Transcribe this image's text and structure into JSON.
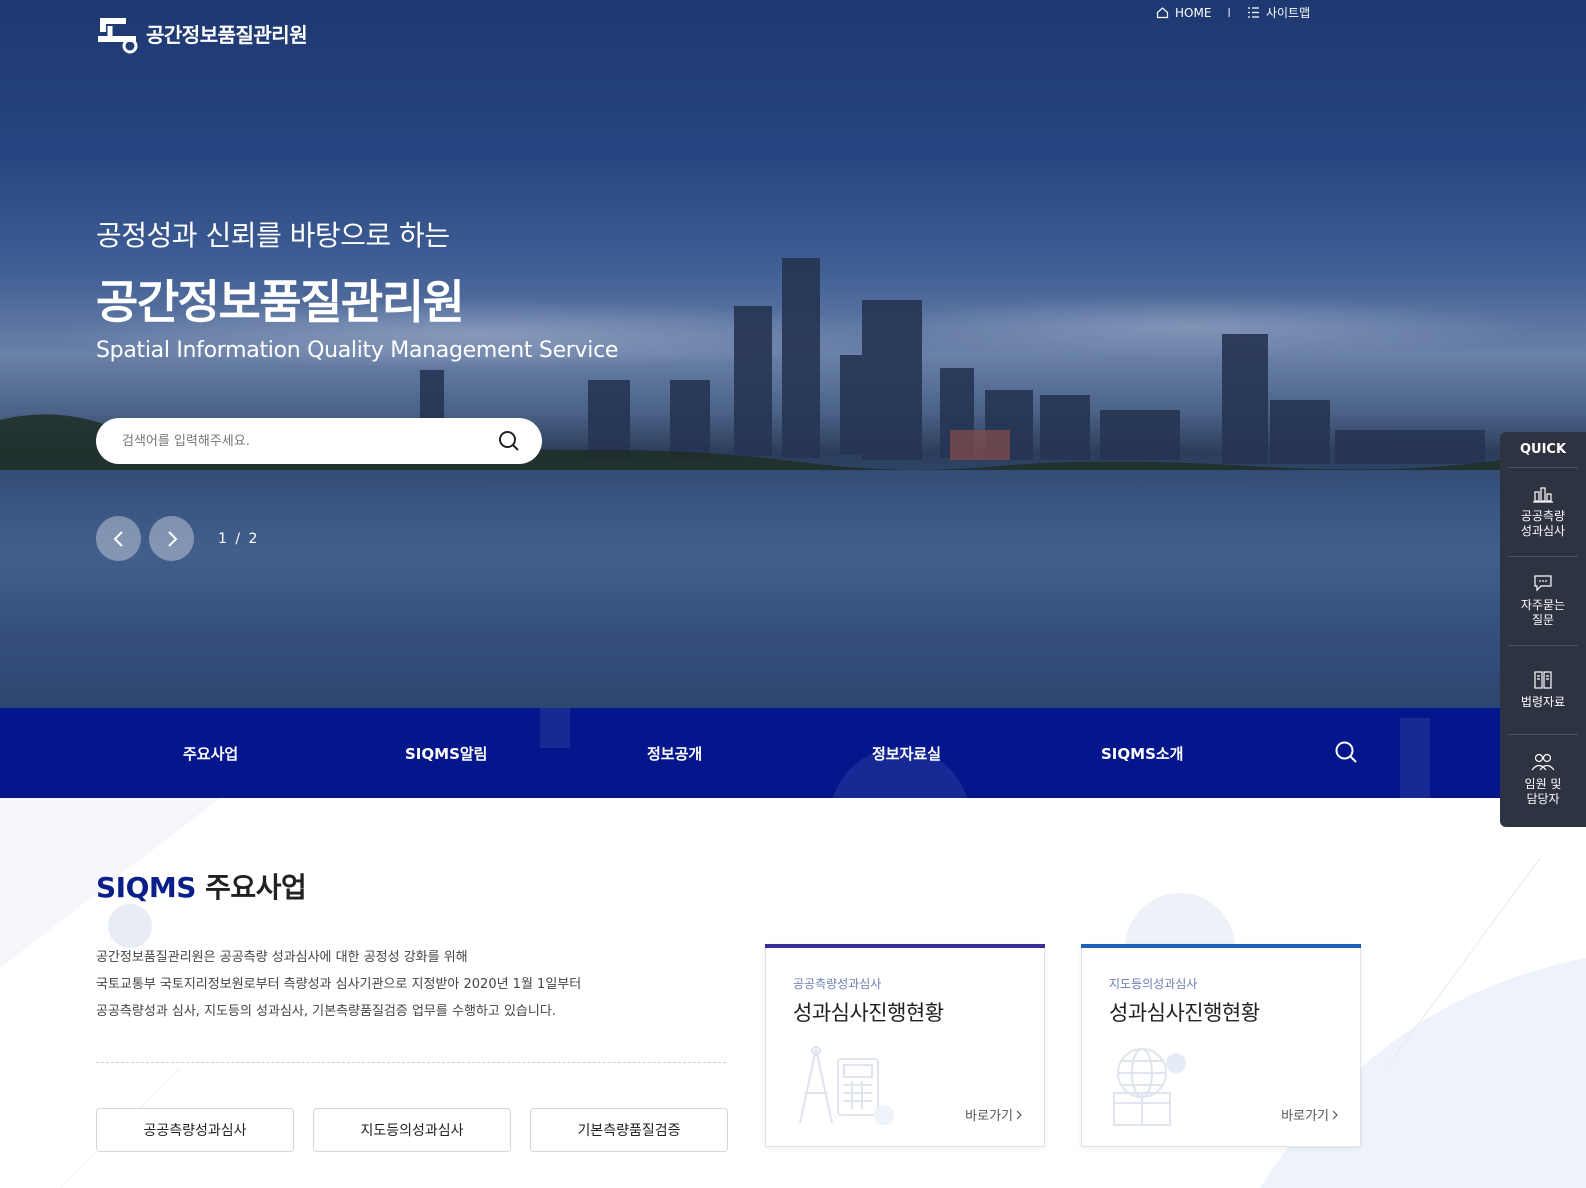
{
  "header": {
    "logo_text": "공간정보품질관리원",
    "utility": {
      "home": "HOME",
      "separator": "I",
      "sitemap": "사이트맵"
    }
  },
  "hero": {
    "subtitle": "공정성과 신뢰를 바탕으로 하는",
    "title": "공간정보품질관리원",
    "english": "Spatial Information Quality Management Service",
    "search_placeholder": "검색어를 입력해주세요.",
    "pager": "1 / 2"
  },
  "nav": {
    "items": [
      {
        "label": "주요사업"
      },
      {
        "label": "SIQMS알림"
      },
      {
        "label": "정보공개"
      },
      {
        "label": "정보자료실"
      },
      {
        "label": "SIQMS소개"
      }
    ]
  },
  "quick": {
    "title": "QUICK",
    "items": [
      {
        "label": "공공측량\n성과심사",
        "icon": "bar-chart-icon"
      },
      {
        "label": "자주묻는\n질문",
        "icon": "chat-bubble-icon"
      },
      {
        "label": "법령자료",
        "icon": "book-icon"
      },
      {
        "label": "임원 및\n담당자",
        "icon": "people-icon"
      }
    ]
  },
  "main": {
    "title_highlight": "SIQMS",
    "title_rest": "주요사업",
    "description": [
      "공간정보품질관리원은 공공측량 성과심사에 대한 공정성 강화를 위해",
      "국토교통부 국토지리정보원로부터 측량성과 심사기관으로 지정받아 2020년 1월 1일부터",
      "공공측량성과 심사, 지도등의 성과심사, 기본측량품질검증 업무를 수행하고 있습니다."
    ],
    "buttons": [
      {
        "label": "공공측량성과심사"
      },
      {
        "label": "지도등의성과심사"
      },
      {
        "label": "기본측량품질검증"
      }
    ],
    "cards": [
      {
        "category": "공공측량성과심사",
        "title": "성과심사진행현황",
        "more": "바로가기",
        "accent": "#3a2f9a"
      },
      {
        "category": "지도등의성과심사",
        "title": "성과심사진행현황",
        "more": "바로가기",
        "accent": "#1c5fb8"
      }
    ]
  },
  "colors": {
    "nav_bg": "#03168c",
    "quick_bg": "#2d3340",
    "title_blue": "#0b1f8a"
  }
}
